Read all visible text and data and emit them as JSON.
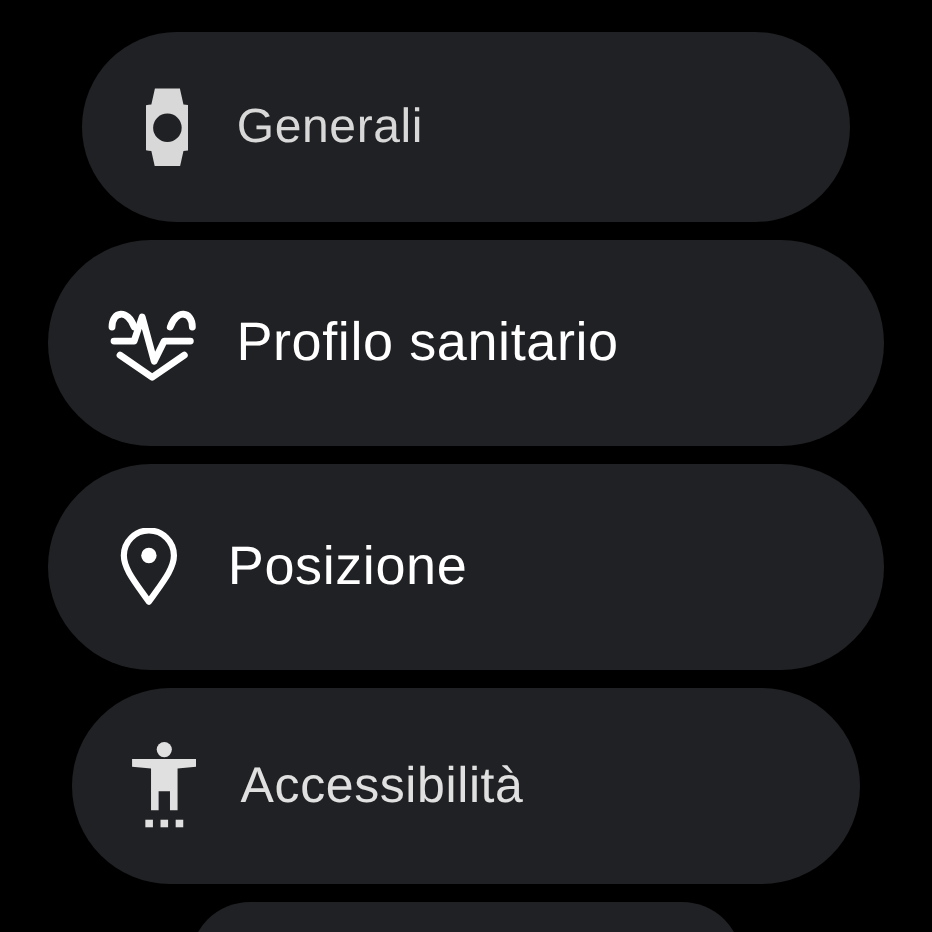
{
  "settings_items": [
    {
      "label": "Generali"
    },
    {
      "label": "Profilo sanitario"
    },
    {
      "label": "Posizione"
    },
    {
      "label": "Accessibilità"
    }
  ]
}
